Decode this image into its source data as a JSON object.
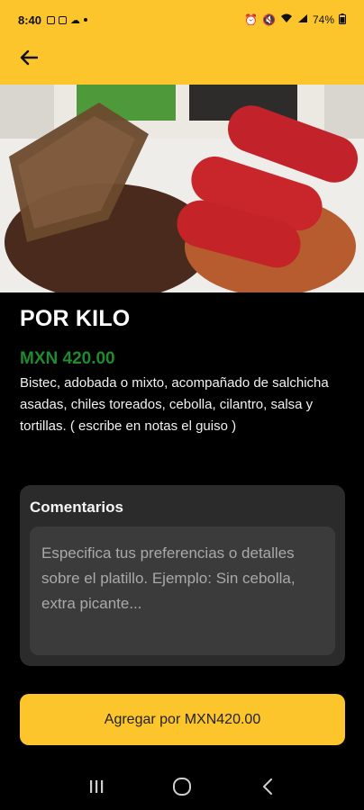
{
  "status_bar": {
    "time": "8:40",
    "battery": "74%"
  },
  "header": {
    "back_icon": "arrow-left-icon",
    "accent_color": "#fcc52b"
  },
  "product": {
    "title": "POR KILO",
    "price": "MXN 420.00",
    "price_color": "#1f8a2e",
    "description": "Bistec, adobada o mixto, acompañado de salchicha asadas, chiles toreados, cebolla, cilantro, salsa y tortillas. ( escribe en notas el guiso )"
  },
  "comments": {
    "label": "Comentarios",
    "placeholder": "Especifica tus preferencias o detalles sobre el platillo. Ejemplo: Sin cebolla, extra picante..."
  },
  "add_button": {
    "label": "Agregar por MXN420.00"
  },
  "nav_bar": {
    "items": [
      "recents-icon",
      "home-icon",
      "back-icon"
    ]
  }
}
